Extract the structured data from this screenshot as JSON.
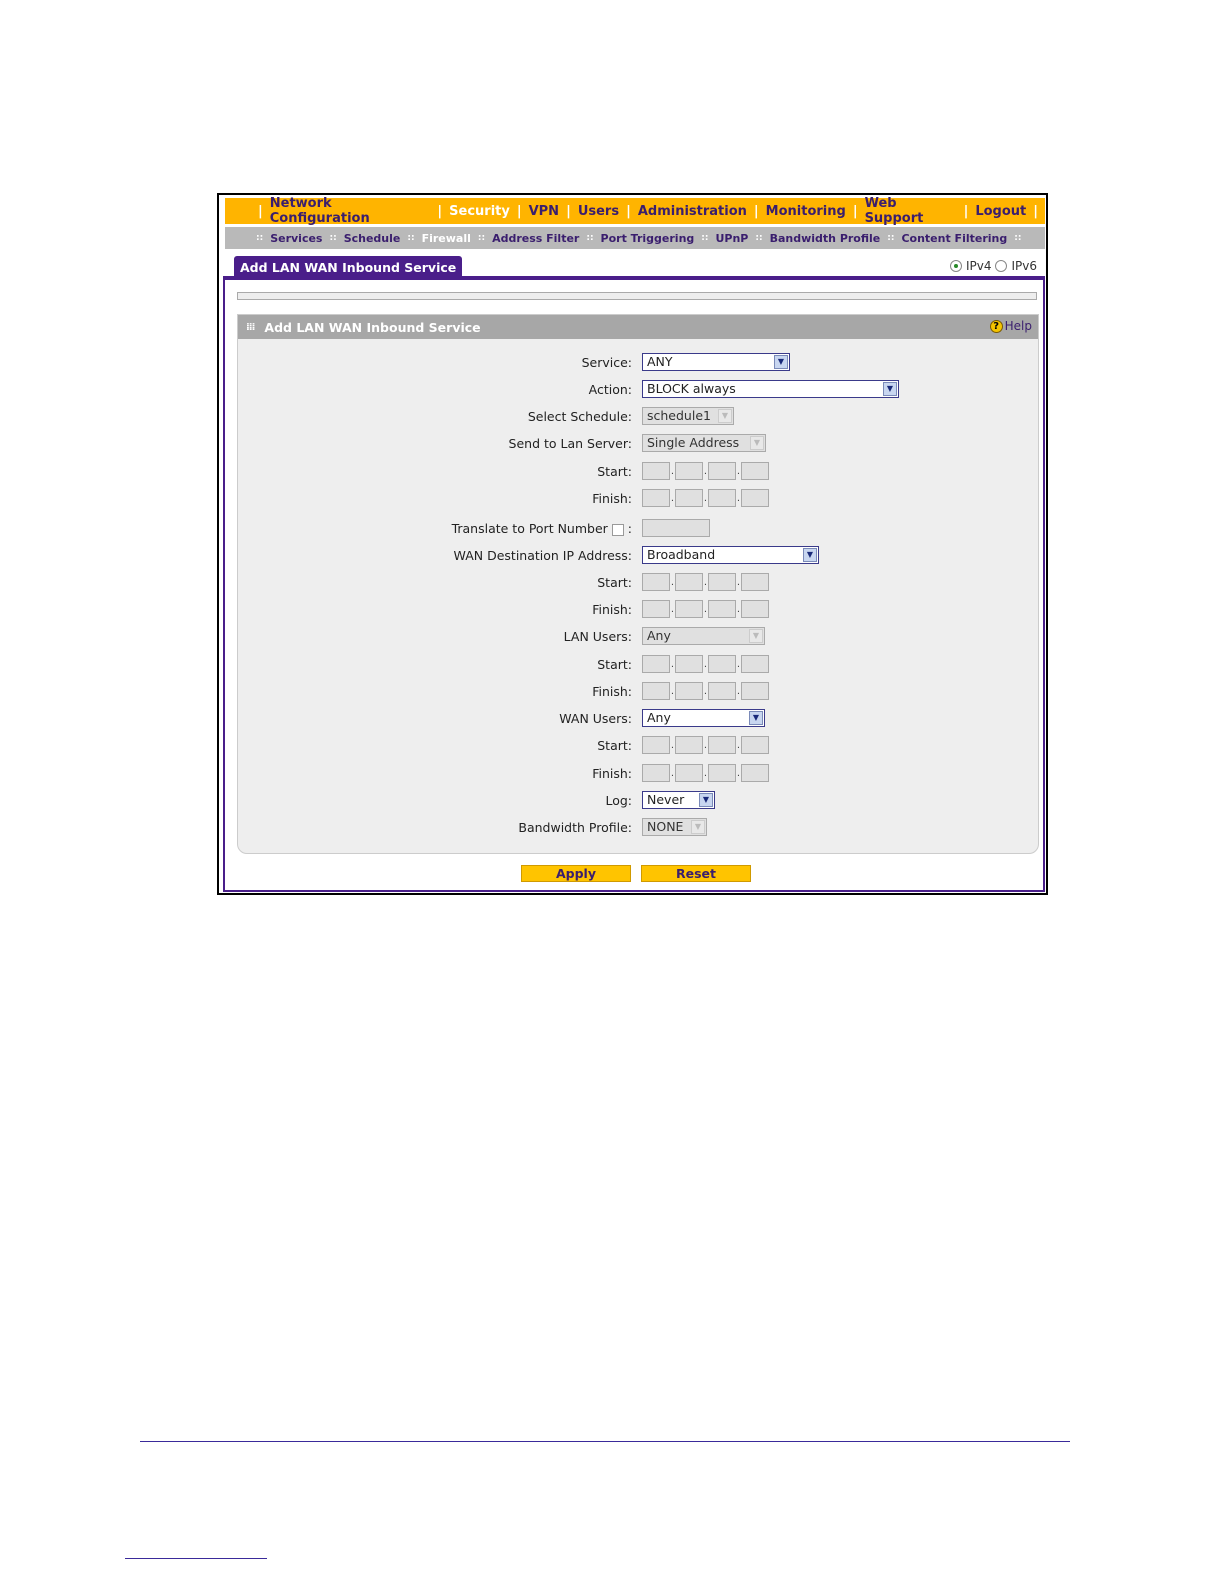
{
  "topnav": [
    {
      "label": "Network Configuration",
      "active": false
    },
    {
      "label": "Security",
      "active": true
    },
    {
      "label": "VPN",
      "active": false
    },
    {
      "label": "Users",
      "active": false
    },
    {
      "label": "Administration",
      "active": false
    },
    {
      "label": "Monitoring",
      "active": false
    },
    {
      "label": "Web Support",
      "active": false
    },
    {
      "label": "Logout",
      "active": false
    }
  ],
  "subnav": [
    {
      "label": "Services",
      "active": false
    },
    {
      "label": "Schedule",
      "active": false
    },
    {
      "label": "Firewall",
      "active": true
    },
    {
      "label": "Address Filter",
      "active": false
    },
    {
      "label": "Port Triggering",
      "active": false
    },
    {
      "label": "UPnP",
      "active": false
    },
    {
      "label": "Bandwidth Profile",
      "active": false
    },
    {
      "label": "Content Filtering",
      "active": false
    }
  ],
  "tab": {
    "label": "Add LAN WAN Inbound Service"
  },
  "ipversion": {
    "ipv4": "IPv4",
    "ipv6": "IPv6",
    "selected": "IPv4"
  },
  "section": {
    "title": "Add LAN WAN Inbound Service",
    "help": "Help"
  },
  "form": {
    "service": {
      "label": "Service:",
      "value": "ANY"
    },
    "action": {
      "label": "Action:",
      "value": "BLOCK always"
    },
    "schedule": {
      "label": "Select Schedule:",
      "value": "schedule1"
    },
    "send_to_lan": {
      "label": "Send to Lan Server:",
      "value": "Single Address"
    },
    "lan_start": {
      "label": "Start:"
    },
    "lan_finish": {
      "label": "Finish:"
    },
    "translate": {
      "label": "Translate to Port Number",
      "suffix": ":"
    },
    "wan_dest": {
      "label": "WAN Destination IP Address:",
      "value": "Broadband"
    },
    "wan_dest_start": {
      "label": "Start:"
    },
    "wan_dest_finish": {
      "label": "Finish:"
    },
    "lan_users": {
      "label": "LAN Users:",
      "value": "Any"
    },
    "lan_users_start": {
      "label": "Start:"
    },
    "lan_users_finish": {
      "label": "Finish:"
    },
    "wan_users": {
      "label": "WAN Users:",
      "value": "Any"
    },
    "wan_users_start": {
      "label": "Start:"
    },
    "wan_users_finish": {
      "label": "Finish:"
    },
    "log": {
      "label": "Log:",
      "value": "Never"
    },
    "bandwidth": {
      "label": "Bandwidth Profile:",
      "value": "NONE"
    }
  },
  "buttons": {
    "apply": "Apply",
    "reset": "Reset"
  }
}
